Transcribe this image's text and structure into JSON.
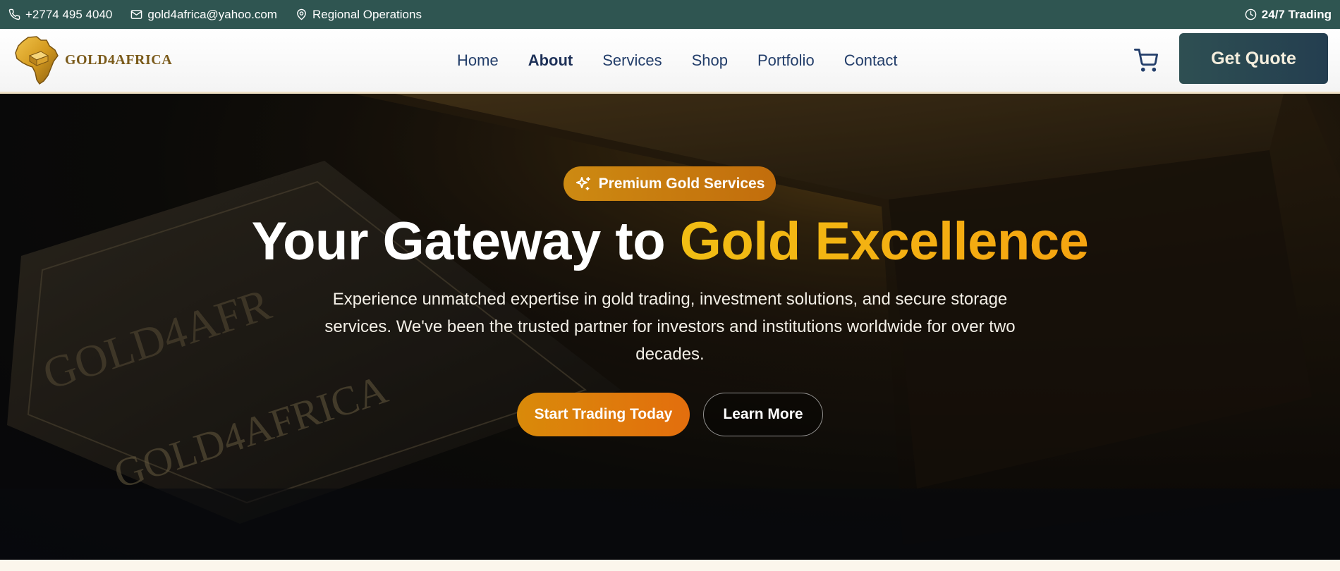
{
  "topbar": {
    "phone": "+2774 495 4040",
    "email": "gold4africa@yahoo.com",
    "location": "Regional Operations",
    "hours": "24/7 Trading"
  },
  "brand": {
    "name": "GOLD4AFRICA"
  },
  "nav": {
    "links": [
      {
        "label": "Home"
      },
      {
        "label": "About"
      },
      {
        "label": "Services"
      },
      {
        "label": "Shop"
      },
      {
        "label": "Portfolio"
      },
      {
        "label": "Contact"
      }
    ],
    "active": "About",
    "cart_icon": "shopping-cart-icon",
    "quote_label": "Get Quote"
  },
  "hero": {
    "badge": "Premium Gold Services",
    "badge_icon": "sparkles-icon",
    "headline_white": "Your Gateway to ",
    "headline_gold": "Gold Excellence",
    "subtext": "Experience unmatched expertise in gold trading, investment solutions, and secure storage services. We've been the trusted partner for investors and institutions worldwide for over two decades.",
    "primary_cta": "Start Trading Today",
    "secondary_cta": "Learn More",
    "bar_text_1": "GOLD4AFR",
    "bar_text_2": "GOLD4AFRICA"
  },
  "colors": {
    "topbar": "#2f5551",
    "nav_text": "#233e6a",
    "gold": "#f2be14",
    "accent_orange": "#d98a0a",
    "quote_button": "#2e4f52"
  }
}
